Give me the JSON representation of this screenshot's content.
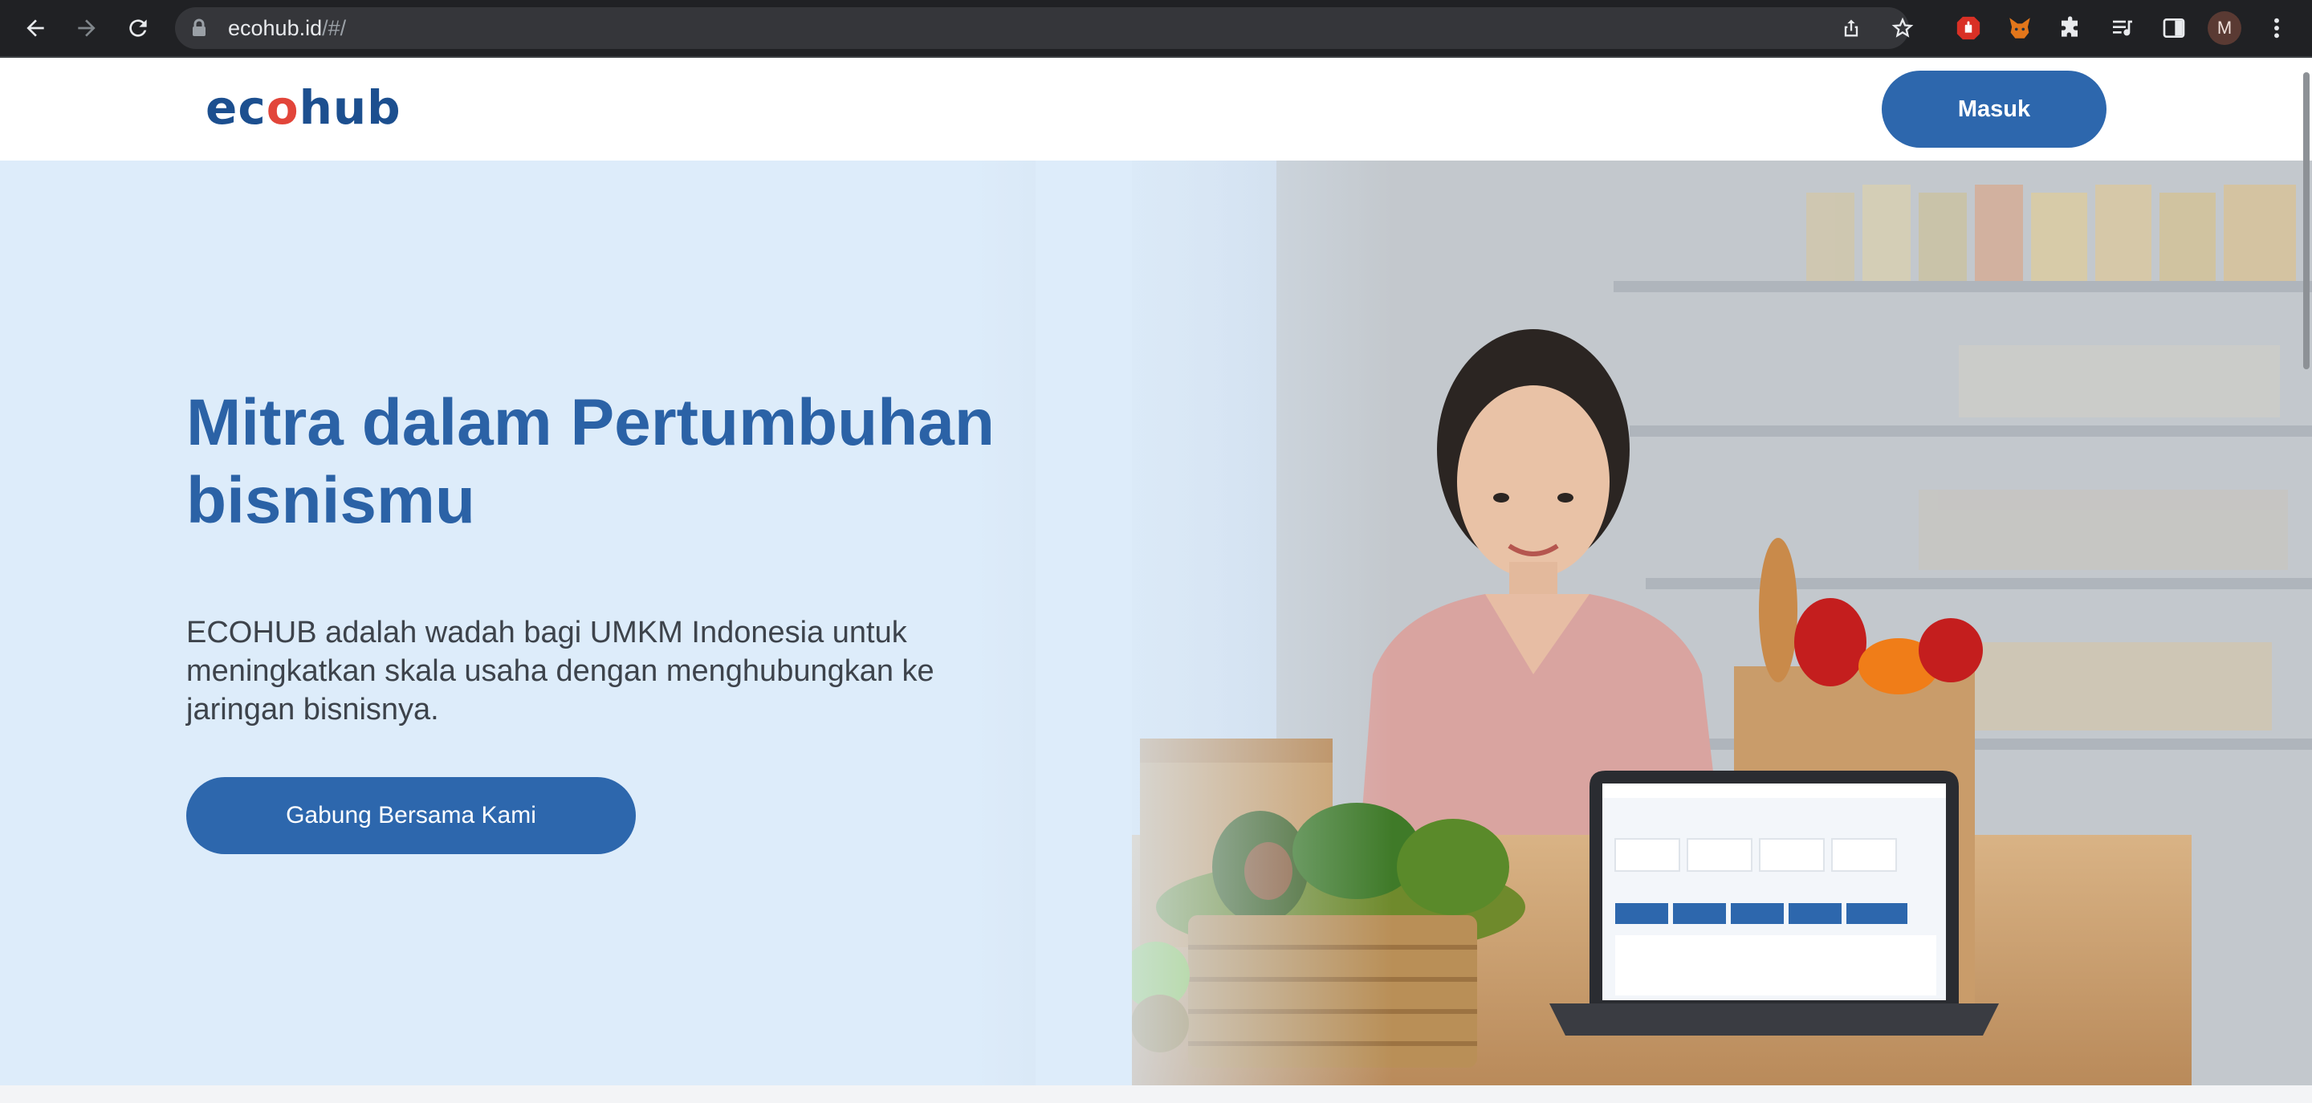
{
  "browser": {
    "url_host": "ecohub.id",
    "url_path": "/#/",
    "profile_initial": "M"
  },
  "header": {
    "logo_left": "ec",
    "logo_mid": "o",
    "logo_right": "hub",
    "login_label": "Masuk"
  },
  "hero": {
    "title": "Mitra dalam Pertumbuhan bisnismu",
    "description": "ECOHUB adalah wadah bagi UMKM Indonesia untuk meningkatkan skala usaha dengan menghubungkan ke jaringan bisnisnya.",
    "cta_label": "Gabung Bersama Kami"
  },
  "colors": {
    "brand": "#2d67ad",
    "title": "#2b62a6",
    "hero_bg": "#ddecfa"
  }
}
